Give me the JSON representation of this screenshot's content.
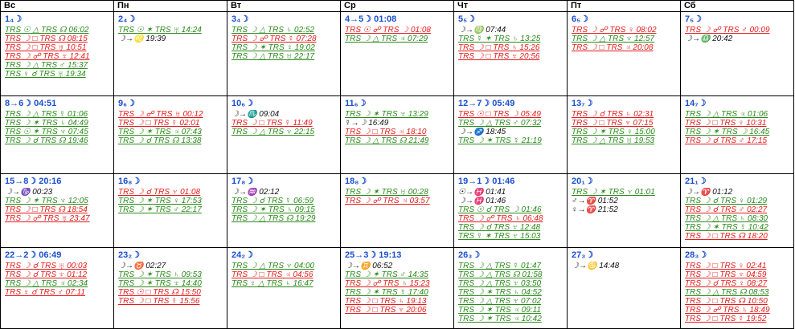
{
  "colors": {
    "green": "#2a8a1a",
    "red": "#e31b1b",
    "blue": "#1a4fd0",
    "black": "#111111"
  },
  "headers": [
    "Вс",
    "Пн",
    "Вт",
    "Ср",
    "Чт",
    "Пт",
    "Сб"
  ],
  "cells": [
    {
      "day": "1₄☽",
      "lines": [
        {
          "c": "g",
          "t": "TRS ☉ △ TRS ☊ 06:02"
        },
        {
          "c": "r",
          "t": "TRS ☽ □ TRS ☊ 08:15"
        },
        {
          "c": "r",
          "t": "TRS ☽ □ TRS ♅ 10:51"
        },
        {
          "c": "r",
          "t": "TRS ☽ ☍ TRS ♆ 12:41"
        },
        {
          "c": "g",
          "t": "TRS ☽ △ TRS ♂ 15:37"
        },
        {
          "c": "g",
          "t": "TRS ♀ ☌ TRS ♅ 19:34"
        }
      ]
    },
    {
      "day": "2₄☽",
      "lines": [
        {
          "c": "g",
          "t": "TRS ☉ ✶ TRS ♅ 14:24"
        },
        {
          "c": "k",
          "t": "☽→♌ 19:39"
        }
      ]
    },
    {
      "day": "3₄☽",
      "lines": [
        {
          "c": "g",
          "t": "TRS ☽ △ TRS ♄ 02:52"
        },
        {
          "c": "r",
          "t": "TRS ☽ ☍ TRS ☿ 07:28"
        },
        {
          "c": "g",
          "t": "TRS ☽ ✶ TRS ♀ 19:02"
        },
        {
          "c": "g",
          "t": "TRS ☽ △ TRS ♅ 22:17"
        }
      ]
    },
    {
      "day": "4→5☽ 01:08",
      "lines": [
        {
          "c": "r",
          "t": "TRS ☉ ☍ TRS ☽ 01:08"
        },
        {
          "c": "g",
          "t": "TRS ☽ △ TRS ♃ 07:29"
        }
      ]
    },
    {
      "day": "5₅☽",
      "lines": [
        {
          "c": "k",
          "t": "☽→♍ 07:44"
        },
        {
          "c": "g",
          "t": "TRS ☿ ✶ TRS ♄ 13:25"
        },
        {
          "c": "r",
          "t": "TRS ☽ □ TRS ♄ 15:26"
        },
        {
          "c": "r",
          "t": "TRS ☽ □ TRS ♆ 20:56"
        }
      ]
    },
    {
      "day": "6₅☽",
      "lines": [
        {
          "c": "r",
          "t": "TRS ☽ ☍ TRS ♀ 08:02"
        },
        {
          "c": "g",
          "t": "TRS ☽ △ TRS ♆ 12:57"
        },
        {
          "c": "r",
          "t": "TRS ☽ □ TRS ♃ 20:08"
        }
      ]
    },
    {
      "day": "7₅☽",
      "lines": [
        {
          "c": "r",
          "t": "TRS ☽ ☍ TRS ♂ 00:09"
        },
        {
          "c": "k",
          "t": "☽→♎ 20:42"
        }
      ]
    },
    {
      "day": "8→6☽ 04:51",
      "lines": [
        {
          "c": "g",
          "t": "TRS ☽ △ TRS ☿ 01:06"
        },
        {
          "c": "g",
          "t": "TRS ☽ ✶ TRS ♄ 04:49"
        },
        {
          "c": "g",
          "t": "TRS ☉ ✶ TRS ♆ 07:45"
        },
        {
          "c": "g",
          "t": "TRS ☽ ☌ TRS ☊ 19:46"
        }
      ]
    },
    {
      "day": "9₆☽",
      "lines": [
        {
          "c": "r",
          "t": "TRS ☽ ☍ TRS ♅ 00:12"
        },
        {
          "c": "r",
          "t": "TRS ☽ □ TRS ☿ 02:01"
        },
        {
          "c": "g",
          "t": "TRS ☽ ✶ TRS ♃ 07:43"
        },
        {
          "c": "g",
          "t": "TRS ☽ ☌ TRS ☊ 13:38"
        }
      ]
    },
    {
      "day": "10₆☽",
      "lines": [
        {
          "c": "k",
          "t": "☽→♏ 09:04"
        },
        {
          "c": "r",
          "t": "TRS ☽ □ TRS ☿ 11:49"
        },
        {
          "c": "g",
          "t": "TRS ☽ △ TRS ♆ 22:15"
        }
      ]
    },
    {
      "day": "11₆☽",
      "lines": [
        {
          "c": "g",
          "t": "TRS ☽ ✶ TRS ♆ 13:29"
        },
        {
          "c": "k",
          "t": "☿→☽ 16:49"
        },
        {
          "c": "r",
          "t": "TRS ☽ □ TRS ♃ 18:10"
        },
        {
          "c": "g",
          "t": "TRS ☽ △ TRS ☊ 21:49"
        }
      ]
    },
    {
      "day": "12→7☽ 05:49",
      "lines": [
        {
          "c": "r",
          "t": "TRS ☉ □ TRS ☽ 05:49"
        },
        {
          "c": "g",
          "t": "TRS ☽ △ TRS ♂ 07:32"
        },
        {
          "c": "k",
          "t": "☽→♐ 18:45"
        },
        {
          "c": "g",
          "t": "TRS ☽ ✶ TRS ☿ 21:19"
        }
      ]
    },
    {
      "day": "13₇☽",
      "lines": [
        {
          "c": "r",
          "t": "TRS ☽ ☌ TRS ♄ 02:31"
        },
        {
          "c": "r",
          "t": "TRS ☽ □ TRS ♆ 07:15"
        },
        {
          "c": "g",
          "t": "TRS ☽ ✶ TRS ♀ 15:00"
        },
        {
          "c": "g",
          "t": "TRS ☽ △ TRS ♅ 19:53"
        }
      ]
    },
    {
      "day": "14₇☽",
      "lines": [
        {
          "c": "g",
          "t": "TRS ☽ △ TRS ♃ 01:06"
        },
        {
          "c": "r",
          "t": "TRS ☽ □ TRS ♀ 10:31"
        },
        {
          "c": "g",
          "t": "TRS ☽ ✶ TRS ☽ 16:45"
        },
        {
          "c": "r",
          "t": "TRS ☽ ☌ TRS ♂ 17:15"
        }
      ]
    },
    {
      "day": "15→8☽ 20:16",
      "lines": [
        {
          "c": "k",
          "t": "☽→♑ 00:23"
        },
        {
          "c": "g",
          "t": "TRS ☽ ✶ TRS ♆ 12:05"
        },
        {
          "c": "r",
          "t": "TRS ☽ □ TRS ☊ 18:54"
        },
        {
          "c": "r",
          "t": "TRS ☽ ☍ TRS ♅ 23:47"
        }
      ]
    },
    {
      "day": "16₈☽",
      "lines": [
        {
          "c": "r",
          "t": "TRS ☽ ☌ TRS ♆ 01:08"
        },
        {
          "c": "g",
          "t": "TRS ☽ ✶ TRS ♀ 17:53"
        },
        {
          "c": "g",
          "t": "TRS ☽ ✶ TRS ♂ 22:17"
        }
      ]
    },
    {
      "day": "17₈☽",
      "lines": [
        {
          "c": "k",
          "t": "☽→♒ 02:12"
        },
        {
          "c": "g",
          "t": "TRS ☽ ☌ TRS ☿ 06:59"
        },
        {
          "c": "g",
          "t": "TRS ☽ ✶ TRS ♄ 09:15"
        },
        {
          "c": "g",
          "t": "TRS ☽ △ TRS ☊ 19:29"
        }
      ]
    },
    {
      "day": "18₈☽",
      "lines": [
        {
          "c": "g",
          "t": "TRS ☽ ✶ TRS ♅ 00:28"
        },
        {
          "c": "r",
          "t": "TRS ☽ ☍ TRS ♃ 03:57"
        }
      ]
    },
    {
      "day": "19→1☽ 01:46",
      "lines": [
        {
          "c": "k",
          "t": "☉→♓ 01:41"
        },
        {
          "c": "k",
          "t": "☽→♓ 01:46"
        },
        {
          "c": "g",
          "t": "TRS ☉ ☌ TRS ☽ 01:46"
        },
        {
          "c": "r",
          "t": "TRS ☽ ☍ TRS ♄ 06:48"
        },
        {
          "c": "g",
          "t": "TRS ☽ ☌ TRS ♆ 12:48"
        },
        {
          "c": "g",
          "t": "TRS ☿ ✶ TRS ♆ 15:03"
        }
      ]
    },
    {
      "day": "20₁☽",
      "lines": [
        {
          "c": "g",
          "t": "TRS ☽ ✶ TRS ♆ 01:01"
        },
        {
          "c": "k",
          "t": "♂→♈ 01:52"
        },
        {
          "c": "k",
          "t": "♀→♈ 21:52"
        }
      ]
    },
    {
      "day": "21₁☽",
      "lines": [
        {
          "c": "k",
          "t": "☽→♈ 01:12"
        },
        {
          "c": "g",
          "t": "TRS ☽ ☌ TRS ♀ 01:29"
        },
        {
          "c": "r",
          "t": "TRS ☽ ☌ TRS ♂ 02:27"
        },
        {
          "c": "g",
          "t": "TRS ☽ △ TRS ♄ 08:30"
        },
        {
          "c": "g",
          "t": "TRS ☽ ✶ TRS ☿ 10:42"
        },
        {
          "c": "r",
          "t": "TRS ☽ □ TRS ☊ 18:20"
        }
      ]
    },
    {
      "day": "22→2☽ 06:49",
      "lines": [
        {
          "c": "r",
          "t": "TRS ☽ ☌ TRS ♅ 00:03"
        },
        {
          "c": "r",
          "t": "TRS ☽ ☌ TRS ♆ 01:12"
        },
        {
          "c": "g",
          "t": "TRS ☽ △ TRS ♃ 02:34"
        },
        {
          "c": "r",
          "t": "TRS ♀ ☌ TRS ♂ 07:11"
        }
      ]
    },
    {
      "day": "23₂☽",
      "lines": [
        {
          "c": "k",
          "t": "☽→♉ 02:27"
        },
        {
          "c": "g",
          "t": "TRS ☽ ✶ TRS ♄ 09:53"
        },
        {
          "c": "g",
          "t": "TRS ☽ ✶ TRS ♆ 14:40"
        },
        {
          "c": "r",
          "t": "TRS ☉ □ TRS ☊ 15:50"
        },
        {
          "c": "r",
          "t": "TRS ☽ □ TRS ☿ 15:56"
        }
      ]
    },
    {
      "day": "24₂☽",
      "lines": [
        {
          "c": "g",
          "t": "TRS ☽ △ TRS ♆ 04:00"
        },
        {
          "c": "r",
          "t": "TRS ☽ □ TRS ♃ 04:56"
        },
        {
          "c": "g",
          "t": "TRS ♀ △ TRS ♄ 16:47"
        }
      ]
    },
    {
      "day": "25→3☽ 19:13",
      "lines": [
        {
          "c": "k",
          "t": "☽→♊ 06:52"
        },
        {
          "c": "g",
          "t": "TRS ☽ ✶ TRS ♂ 14:35"
        },
        {
          "c": "r",
          "t": "TRS ☽ ☍ TRS ♄ 15:23"
        },
        {
          "c": "g",
          "t": "TRS ☽ ✶ TRS ☿ 17:40"
        },
        {
          "c": "r",
          "t": "TRS ☽ □ TRS ♄ 19:13"
        },
        {
          "c": "r",
          "t": "TRS ☽ □ TRS ♆ 20:06"
        }
      ]
    },
    {
      "day": "26₃☽",
      "lines": [
        {
          "c": "g",
          "t": "TRS ☽ △ TRS ☿ 01:47"
        },
        {
          "c": "g",
          "t": "TRS ☽ △ TRS ☊ 01:58"
        },
        {
          "c": "g",
          "t": "TRS ☽ △ TRS ♆ 03:50"
        },
        {
          "c": "g",
          "t": "TRS ☽ ✶ TRS ♄ 04:52"
        },
        {
          "c": "g",
          "t": "TRS ☽ △ TRS ♆ 07:02"
        },
        {
          "c": "g",
          "t": "TRS ☽ ✶ TRS ♃ 09:11"
        },
        {
          "c": "g",
          "t": "TRS ☽ ✶ TRS ♃ 10:42"
        }
      ]
    },
    {
      "day": "27₃☽",
      "lines": [
        {
          "c": "k",
          "t": "☽→♋ 14:48"
        }
      ]
    },
    {
      "day": "28₃☽",
      "lines": [
        {
          "c": "r",
          "t": "TRS ☽ □ TRS ♀ 02:41"
        },
        {
          "c": "r",
          "t": "TRS ☽ □ TRS ♆ 04:59"
        },
        {
          "c": "r",
          "t": "TRS ☽ ☌ TRS ♀ 08:27"
        },
        {
          "c": "g",
          "t": "TRS ☽ △ TRS ☊ 08:53"
        },
        {
          "c": "r",
          "t": "TRS ☽ □ TRS ☊ 10:50"
        },
        {
          "c": "r",
          "t": "TRS ☽ ☍ TRS ♄ 18:49"
        },
        {
          "c": "r",
          "t": "TRS ☽ □ TRS ☿ 19:52"
        }
      ]
    }
  ]
}
